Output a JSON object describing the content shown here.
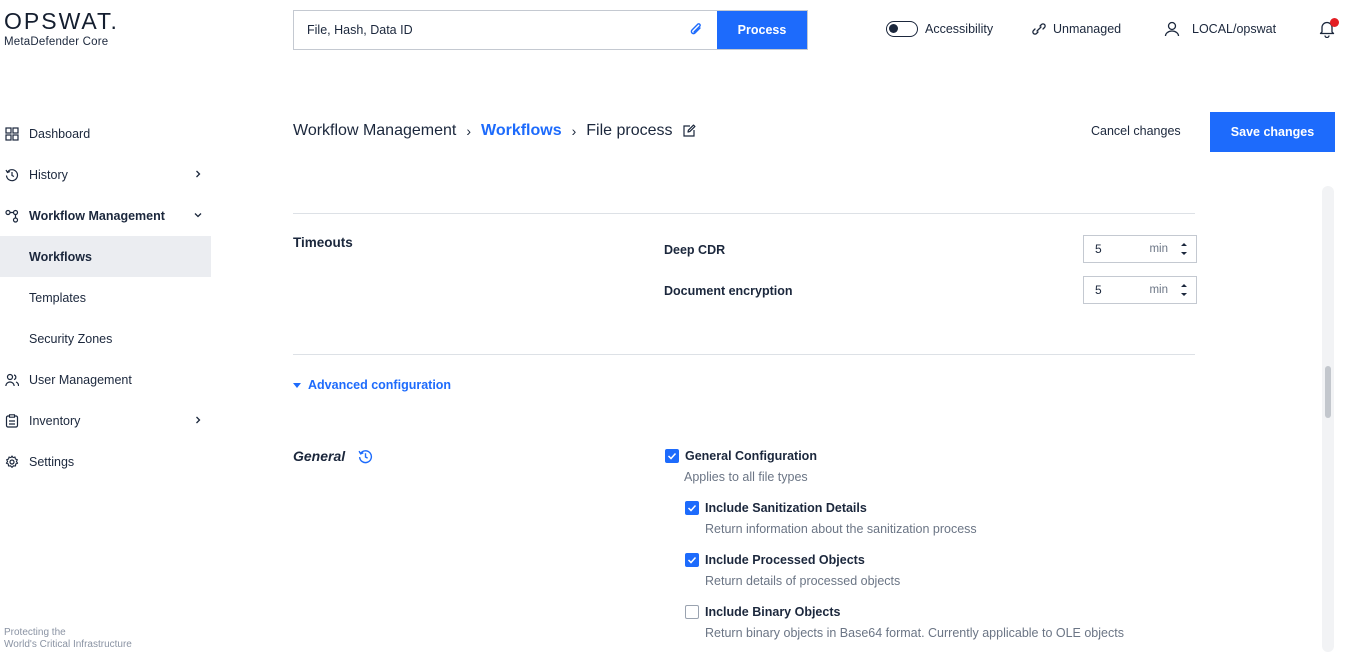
{
  "logo": {
    "brand": "OPSWAT.",
    "product": "MetaDefender Core"
  },
  "search": {
    "placeholder": "File, Hash, Data ID",
    "process_label": "Process"
  },
  "topbar": {
    "accessibility": "Accessibility",
    "unmanaged": "Unmanaged",
    "user": "LOCAL/opswat"
  },
  "sidebar": {
    "dashboard": "Dashboard",
    "history": "History",
    "workflow_management": "Workflow Management",
    "workflows": "Workflows",
    "templates": "Templates",
    "security_zones": "Security Zones",
    "user_management": "User Management",
    "inventory": "Inventory",
    "settings": "Settings",
    "tagline_1": "Protecting the",
    "tagline_2": "World's Critical Infrastructure"
  },
  "breadcrumb": {
    "root": "Workflow Management",
    "parent": "Workflows",
    "current": "File process",
    "sep": "›"
  },
  "actions": {
    "cancel": "Cancel changes",
    "save": "Save changes"
  },
  "timeouts": {
    "title": "Timeouts",
    "deep_cdr": {
      "label": "Deep CDR",
      "value": "5",
      "unit": "min"
    },
    "doc_encryption": {
      "label": "Document encryption",
      "value": "5",
      "unit": "min"
    }
  },
  "advanced": {
    "label": "Advanced configuration"
  },
  "general": {
    "title": "General",
    "items": [
      {
        "label": "General Configuration",
        "desc": "Applies to all file types",
        "checked": true
      },
      {
        "label": "Include Sanitization Details",
        "desc": "Return information about the sanitization process",
        "checked": true
      },
      {
        "label": "Include Processed Objects",
        "desc": "Return details of processed objects",
        "checked": true
      },
      {
        "label": "Include Binary Objects",
        "desc": "Return binary objects in Base64 format. Currently applicable to OLE objects",
        "checked": false
      }
    ]
  },
  "colors": {
    "accent": "#1d6bfc",
    "alert": "#e31e24",
    "text": "#1b273c",
    "muted": "#6b7585"
  }
}
